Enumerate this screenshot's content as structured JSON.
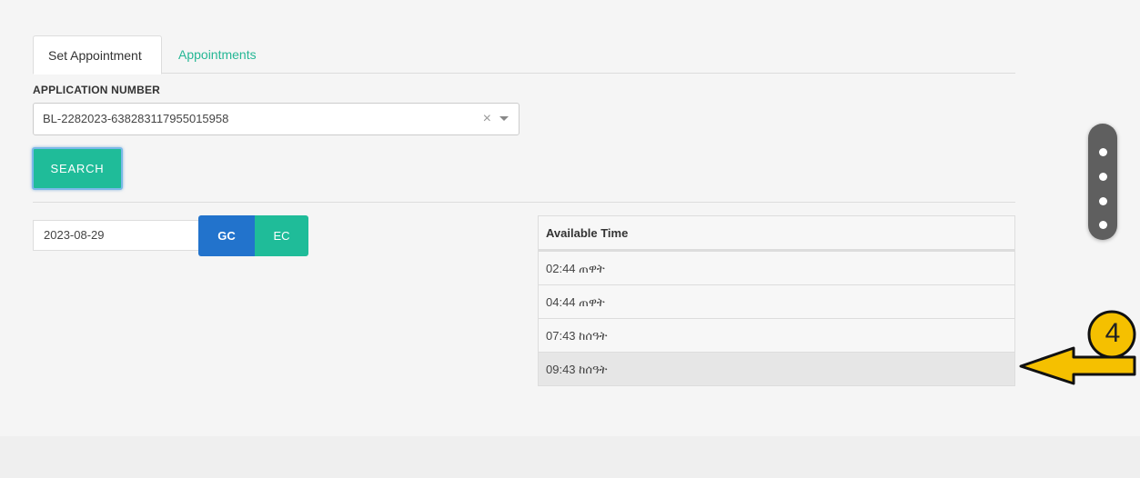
{
  "tabs": [
    {
      "label": "Set Appointment",
      "active": true
    },
    {
      "label": "Appointments",
      "active": false
    }
  ],
  "application": {
    "label": "APPLICATION NUMBER",
    "value": "BL-2282023-638283117955015958",
    "clear_symbol": "×"
  },
  "search": {
    "label": "SEARCH"
  },
  "date": {
    "value": "2023-08-29",
    "gc_label": "GC",
    "ec_label": "EC"
  },
  "available_time": {
    "header": "Available Time",
    "rows": [
      "02:44 ጠዋት",
      "04:44 ጠዋት",
      "07:43 ከሰዓት",
      "09:43 ከሰዓት"
    ]
  },
  "annotation": {
    "step": "4"
  },
  "colors": {
    "accent_green": "#1fbc99",
    "primary_blue": "#2273cc",
    "link_green": "#26b795",
    "annotation_yellow": "#f5c000"
  },
  "icons": [
    "clear-icon",
    "chevron-down-icon",
    "more-vertical-icon",
    "arrow-left-icon"
  ]
}
